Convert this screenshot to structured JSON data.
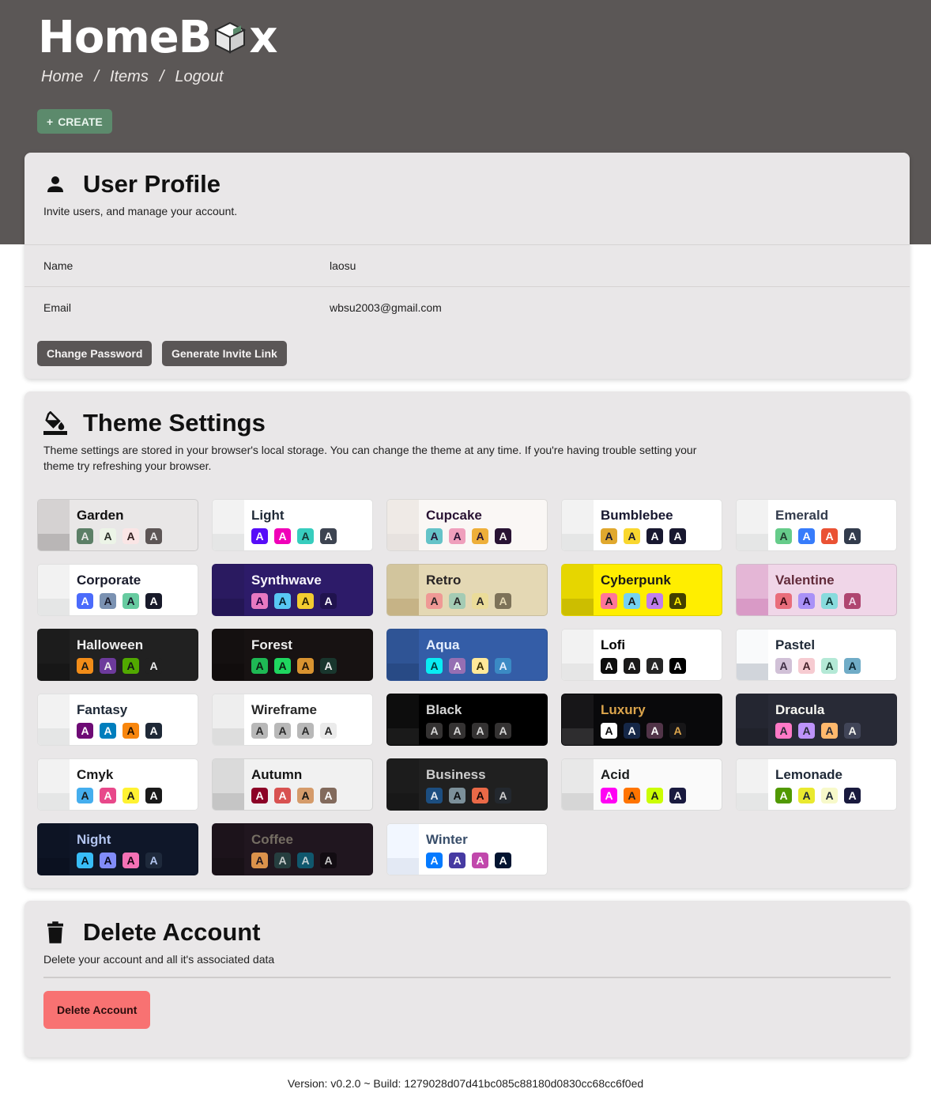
{
  "header": {
    "logo_prefix": "HomeB",
    "logo_suffix": "x",
    "nav": [
      "Home",
      "/",
      "Items",
      "/",
      "Logout"
    ],
    "create_label": "CREATE"
  },
  "profile": {
    "title": "User Profile",
    "description": "Invite users, and manage your account.",
    "rows": [
      {
        "key": "Name",
        "value": "laosu"
      },
      {
        "key": "Email",
        "value": "wbsu2003@gmail.com"
      }
    ],
    "change_password_label": "Change Password",
    "invite_label": "Generate Invite Link"
  },
  "theme_settings": {
    "title": "Theme Settings",
    "description_line1": "Theme settings are stored in your browser's local storage. You can change the theme at any time. If you're having trouble setting your",
    "description_line2": "theme try refreshing your browser.",
    "themes": [
      {
        "name": "Garden",
        "bg": "#e9e7e7",
        "text": "#100f0f",
        "sw_top": "#d5d2d2",
        "sw_bot": "#b9b6b6",
        "chips": [
          {
            "bg": "#5c7f67",
            "fg": "#e9e7e7"
          },
          {
            "bg": "#ecf4e7",
            "fg": "#292e27"
          },
          {
            "bg": "#fae5e5",
            "fg": "#322020"
          },
          {
            "bg": "#5d5656",
            "fg": "#e9e7e7"
          }
        ]
      },
      {
        "name": "Light",
        "bg": "#ffffff",
        "text": "#1f2937",
        "sw_top": "#f2f2f2",
        "sw_bot": "#e5e6e6",
        "chips": [
          {
            "bg": "#570df8",
            "fg": "#ffffff"
          },
          {
            "bg": "#f000b8",
            "fg": "#ffffff"
          },
          {
            "bg": "#37cdbe",
            "fg": "#163835"
          },
          {
            "bg": "#3d4451",
            "fg": "#ffffff"
          }
        ]
      },
      {
        "name": "Cupcake",
        "bg": "#faf7f5",
        "text": "#291334",
        "sw_top": "#efeae6",
        "sw_bot": "#e7e2df",
        "chips": [
          {
            "bg": "#65c3c8",
            "fg": "#291334"
          },
          {
            "bg": "#ef9fbc",
            "fg": "#291334"
          },
          {
            "bg": "#eeaf3a",
            "fg": "#291334"
          },
          {
            "bg": "#291334",
            "fg": "#faf7f5"
          }
        ]
      },
      {
        "name": "Bumblebee",
        "bg": "#ffffff",
        "text": "#181830",
        "sw_top": "#f2f2f2",
        "sw_bot": "#e5e6e6",
        "chips": [
          {
            "bg": "#e0a82e",
            "fg": "#181830"
          },
          {
            "bg": "#f9d72f",
            "fg": "#181830"
          },
          {
            "bg": "#181830",
            "fg": "#ffffff"
          },
          {
            "bg": "#181830",
            "fg": "#ffffff"
          }
        ]
      },
      {
        "name": "Emerald",
        "bg": "#ffffff",
        "text": "#333c4d",
        "sw_top": "#f2f2f2",
        "sw_bot": "#e5e6e6",
        "chips": [
          {
            "bg": "#66cc8a",
            "fg": "#223d30"
          },
          {
            "bg": "#377cfb",
            "fg": "#ffffff"
          },
          {
            "bg": "#ea5234",
            "fg": "#ffffff"
          },
          {
            "bg": "#333c4d",
            "fg": "#ffffff"
          }
        ]
      },
      {
        "name": "Corporate",
        "bg": "#ffffff",
        "text": "#181a2a",
        "sw_top": "#f2f2f2",
        "sw_bot": "#e5e6e6",
        "chips": [
          {
            "bg": "#4b6bfb",
            "fg": "#ffffff"
          },
          {
            "bg": "#7b92b2",
            "fg": "#181a2a"
          },
          {
            "bg": "#67cba0",
            "fg": "#181a2a"
          },
          {
            "bg": "#181a2a",
            "fg": "#ffffff"
          }
        ]
      },
      {
        "name": "Synthwave",
        "bg": "#2d1b69",
        "text": "#f9f7fd",
        "sw_top": "#2a1a60",
        "sw_bot": "#241655",
        "chips": [
          {
            "bg": "#e779c1",
            "fg": "#204"
          },
          {
            "bg": "#58c7f3",
            "fg": "#041f2a"
          },
          {
            "bg": "#f3cc30",
            "fg": "#2a2104"
          },
          {
            "bg": "#20134e",
            "fg": "#f9f7fd"
          }
        ]
      },
      {
        "name": "Retro",
        "bg": "#e4d8b4",
        "text": "#282425",
        "sw_top": "#d2c59d",
        "sw_bot": "#c6b386",
        "chips": [
          {
            "bg": "#ef9995",
            "fg": "#282425"
          },
          {
            "bg": "#a4cbb4",
            "fg": "#282425"
          },
          {
            "bg": "#ebdc99",
            "fg": "#282425"
          },
          {
            "bg": "#7d7259",
            "fg": "#e4d8b4"
          }
        ]
      },
      {
        "name": "Cyberpunk",
        "bg": "#ffee00",
        "text": "#1a1a1a",
        "sw_top": "#e6d600",
        "sw_bot": "#ccbe00",
        "chips": [
          {
            "bg": "#ff7598",
            "fg": "#1a1a1a"
          },
          {
            "bg": "#75d1f0",
            "fg": "#1a1a1a"
          },
          {
            "bg": "#c07eec",
            "fg": "#1a1a1a"
          },
          {
            "bg": "#423f00",
            "fg": "#ffee00"
          }
        ]
      },
      {
        "name": "Valentine",
        "bg": "#f0d6e8",
        "text": "#632c3b",
        "sw_top": "#e4b6d6",
        "sw_bot": "#d99ac6",
        "chips": [
          {
            "bg": "#e96d7b",
            "fg": "#3b0b12"
          },
          {
            "bg": "#a991f7",
            "fg": "#1e0c43"
          },
          {
            "bg": "#88dbdd",
            "fg": "#0d3333"
          },
          {
            "bg": "#af4670",
            "fg": "#f0d6e8"
          }
        ]
      },
      {
        "name": "Halloween",
        "bg": "#212121",
        "text": "#eeeeee",
        "sw_top": "#1c1c1c",
        "sw_bot": "#171717",
        "chips": [
          {
            "bg": "#f28c18",
            "fg": "#131616"
          },
          {
            "bg": "#6d3a9c",
            "fg": "#eeeeee"
          },
          {
            "bg": "#51a800",
            "fg": "#131616"
          },
          {
            "bg": "#212121",
            "fg": "#eeeeee"
          }
        ]
      },
      {
        "name": "Forest",
        "bg": "#171212",
        "text": "#eeeeee",
        "sw_top": "#141010",
        "sw_bot": "#110d0d",
        "chips": [
          {
            "bg": "#1eb854",
            "fg": "#0b1d11"
          },
          {
            "bg": "#1fd65f",
            "fg": "#0b1d11"
          },
          {
            "bg": "#d99330",
            "fg": "#1d1207"
          },
          {
            "bg": "#19362d",
            "fg": "#eeeeee"
          }
        ]
      },
      {
        "name": "Aqua",
        "bg": "#345da7",
        "text": "#e6f0ff",
        "sw_top": "#2f5495",
        "sw_bot": "#284a85",
        "chips": [
          {
            "bg": "#09ecf3",
            "fg": "#01383a"
          },
          {
            "bg": "#966fb3",
            "fg": "#fff"
          },
          {
            "bg": "#ffe999",
            "fg": "#3b3000"
          },
          {
            "bg": "#3b8ac4",
            "fg": "#e6f0ff"
          }
        ]
      },
      {
        "name": "Lofi",
        "bg": "#ffffff",
        "text": "#000000",
        "sw_top": "#f2f2f2",
        "sw_bot": "#e6e6e6",
        "chips": [
          {
            "bg": "#0d0d0d",
            "fg": "#ffffff"
          },
          {
            "bg": "#1a1919",
            "fg": "#ffffff"
          },
          {
            "bg": "#262626",
            "fg": "#ffffff"
          },
          {
            "bg": "#000000",
            "fg": "#ffffff"
          }
        ]
      },
      {
        "name": "Pastel",
        "bg": "#ffffff",
        "text": "#1f2937",
        "sw_top": "#f9fafb",
        "sw_bot": "#d1d5db",
        "chips": [
          {
            "bg": "#d1c1d7",
            "fg": "#3e2e44"
          },
          {
            "bg": "#f6cbd1",
            "fg": "#45222a"
          },
          {
            "bg": "#b4e9d6",
            "fg": "#1a3f33"
          },
          {
            "bg": "#70acc7",
            "fg": "#0d2733"
          }
        ]
      },
      {
        "name": "Fantasy",
        "bg": "#ffffff",
        "text": "#1f2937",
        "sw_top": "#f2f2f2",
        "sw_bot": "#e5e6e6",
        "chips": [
          {
            "bg": "#6e0b75",
            "fg": "#ffffff"
          },
          {
            "bg": "#007ebd",
            "fg": "#ffffff"
          },
          {
            "bg": "#f8860d",
            "fg": "#221000"
          },
          {
            "bg": "#1f2937",
            "fg": "#ffffff"
          }
        ]
      },
      {
        "name": "Wireframe",
        "bg": "#ffffff",
        "text": "#282828",
        "sw_top": "#eeeeee",
        "sw_bot": "#dddddd",
        "chips": [
          {
            "bg": "#b8b8b8",
            "fg": "#282828"
          },
          {
            "bg": "#b8b8b8",
            "fg": "#282828"
          },
          {
            "bg": "#b8b8b8",
            "fg": "#282828"
          },
          {
            "bg": "#ebebeb",
            "fg": "#282828"
          }
        ]
      },
      {
        "name": "Black",
        "bg": "#000000",
        "text": "#d6d6d6",
        "sw_top": "#0d0d0d",
        "sw_bot": "#1a1a1a",
        "chips": [
          {
            "bg": "#343232",
            "fg": "#d6d6d6"
          },
          {
            "bg": "#343232",
            "fg": "#d6d6d6"
          },
          {
            "bg": "#343232",
            "fg": "#d6d6d6"
          },
          {
            "bg": "#343232",
            "fg": "#d6d6d6"
          }
        ]
      },
      {
        "name": "Luxury",
        "bg": "#09090b",
        "text": "#dca54c",
        "sw_top": "#171618",
        "sw_bot": "#2e2d2f",
        "chips": [
          {
            "bg": "#ffffff",
            "fg": "#09090b"
          },
          {
            "bg": "#152747",
            "fg": "#ffffff"
          },
          {
            "bg": "#513448",
            "fg": "#ffffff"
          },
          {
            "bg": "#171618",
            "fg": "#dca54c"
          }
        ]
      },
      {
        "name": "Dracula",
        "bg": "#282a36",
        "text": "#f8f8f2",
        "sw_top": "#242631",
        "sw_bot": "#20222b",
        "chips": [
          {
            "bg": "#ff79c6",
            "fg": "#282a36"
          },
          {
            "bg": "#bd93f9",
            "fg": "#282a36"
          },
          {
            "bg": "#ffb86c",
            "fg": "#282a36"
          },
          {
            "bg": "#414558",
            "fg": "#f8f8f2"
          }
        ]
      },
      {
        "name": "Cmyk",
        "bg": "#ffffff",
        "text": "#1a1a1a",
        "sw_top": "#f2f2f2",
        "sw_bot": "#e5e6e6",
        "chips": [
          {
            "bg": "#45aeee",
            "fg": "#1a1a1a"
          },
          {
            "bg": "#e8488a",
            "fg": "#ffffff"
          },
          {
            "bg": "#fff232",
            "fg": "#1a1a1a"
          },
          {
            "bg": "#1a1a1a",
            "fg": "#ffffff"
          }
        ]
      },
      {
        "name": "Autumn",
        "bg": "#f1f1f1",
        "text": "#141414",
        "sw_top": "#dadada",
        "sw_bot": "#c5c5c5",
        "chips": [
          {
            "bg": "#8c0327",
            "fg": "#ffffff"
          },
          {
            "bg": "#d85251",
            "fg": "#ffffff"
          },
          {
            "bg": "#d59b6a",
            "fg": "#141414"
          },
          {
            "bg": "#826a5c",
            "fg": "#ffffff"
          }
        ]
      },
      {
        "name": "Business",
        "bg": "#202020",
        "text": "#cdcdcd",
        "sw_top": "#1c1c1c",
        "sw_bot": "#181818",
        "chips": [
          {
            "bg": "#1c4e80",
            "fg": "#e4eaf0"
          },
          {
            "bg": "#7c909a",
            "fg": "#0a0c0e"
          },
          {
            "bg": "#ea6947",
            "fg": "#140806"
          },
          {
            "bg": "#23282e",
            "fg": "#cdcdcd"
          }
        ]
      },
      {
        "name": "Acid",
        "bg": "#fafafa",
        "text": "#1b1d1d",
        "sw_top": "#e8e8e8",
        "sw_bot": "#d6d6d6",
        "chips": [
          {
            "bg": "#ff00f4",
            "fg": "#ffffff"
          },
          {
            "bg": "#ff7400",
            "fg": "#1b1d1d"
          },
          {
            "bg": "#cbfd03",
            "fg": "#1b1d1d"
          },
          {
            "bg": "#191a3f",
            "fg": "#ffffff"
          }
        ]
      },
      {
        "name": "Lemonade",
        "bg": "#ffffff",
        "text": "#1f2937",
        "sw_top": "#f2f2f2",
        "sw_bot": "#e5e6e6",
        "chips": [
          {
            "bg": "#519903",
            "fg": "#ffffff"
          },
          {
            "bg": "#e9e92f",
            "fg": "#1f2937"
          },
          {
            "bg": "#f7f9ca",
            "fg": "#1f2937"
          },
          {
            "bg": "#191a3e",
            "fg": "#ffffff"
          }
        ]
      },
      {
        "name": "Night",
        "bg": "#0f1729",
        "text": "#b3c5ef",
        "sw_top": "#0d1424",
        "sw_bot": "#0b1120",
        "chips": [
          {
            "bg": "#38bdf8",
            "fg": "#010d15"
          },
          {
            "bg": "#818cf8",
            "fg": "#050617"
          },
          {
            "bg": "#f471b5",
            "fg": "#190211"
          },
          {
            "bg": "#1e293b",
            "fg": "#b3c5ef"
          }
        ]
      },
      {
        "name": "Coffee",
        "bg": "#20161f",
        "text": "#756e63",
        "sw_top": "#1c131b",
        "sw_bot": "#181117",
        "chips": [
          {
            "bg": "#db924b",
            "fg": "#20161f"
          },
          {
            "bg": "#263e3f",
            "fg": "#c5cbcb"
          },
          {
            "bg": "#10576d",
            "fg": "#c2d0d4"
          },
          {
            "bg": "#120c12",
            "fg": "#c5c5c5"
          }
        ]
      },
      {
        "name": "Winter",
        "bg": "#ffffff",
        "text": "#394e6a",
        "sw_top": "#f2f7ff",
        "sw_bot": "#e3e9f4",
        "chips": [
          {
            "bg": "#047aff",
            "fg": "#ffffff"
          },
          {
            "bg": "#463aa2",
            "fg": "#ffffff"
          },
          {
            "bg": "#c148ac",
            "fg": "#ffffff"
          },
          {
            "bg": "#021431",
            "fg": "#ffffff"
          }
        ]
      }
    ]
  },
  "delete_account": {
    "title": "Delete Account",
    "description": "Delete your account and all it's associated data",
    "button_label": "Delete Account"
  },
  "footer": {
    "version": "Version: v0.2.0 ~ Build: 1279028d07d41bc085c88180d0830cc68cc6f0ed"
  },
  "chip_letter": "A",
  "colors": {
    "header_bg": "#5b5756",
    "card_bg": "#e9e7e8",
    "create_btn": "#5c8a6c",
    "danger": "#f87272"
  }
}
